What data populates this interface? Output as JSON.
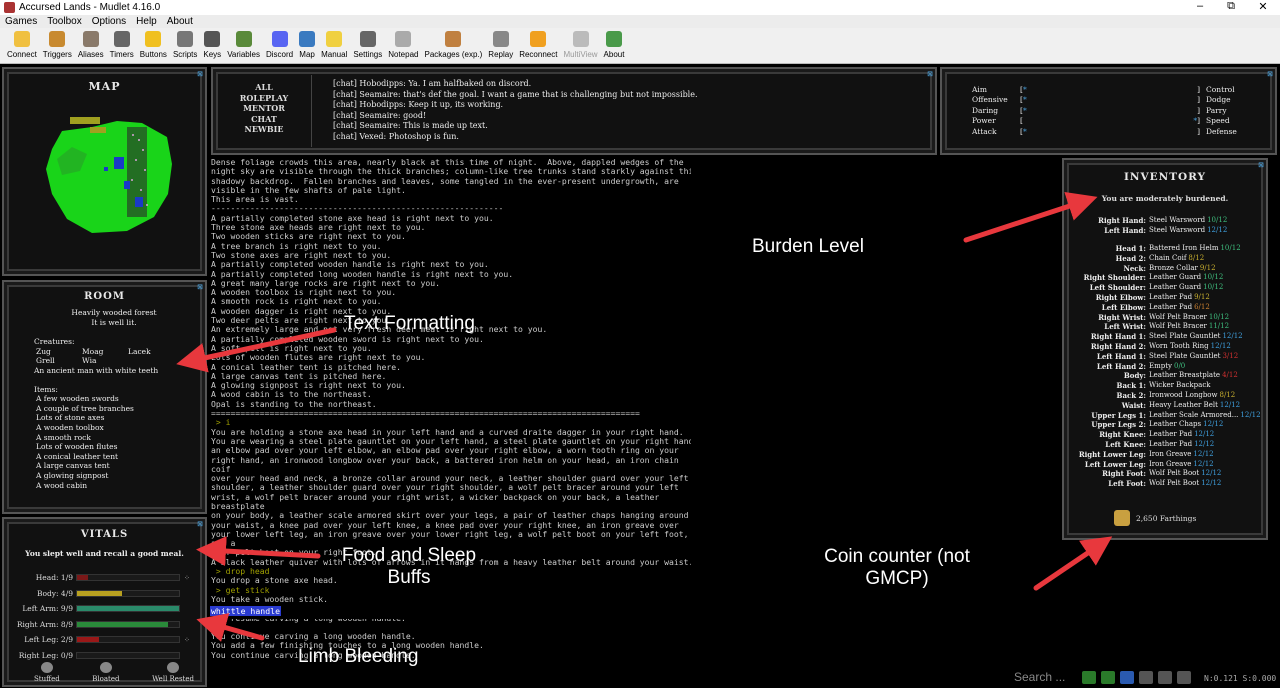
{
  "window": {
    "title": "Accursed Lands - Mudlet 4.16.0",
    "minimize": "–",
    "maximize": "⧉",
    "close": "✕"
  },
  "menu": [
    "Games",
    "Toolbox",
    "Options",
    "Help",
    "About"
  ],
  "toolbar": [
    {
      "label": "Connect",
      "icon": "connect-icon",
      "color": "#f0c040"
    },
    {
      "label": "Triggers",
      "icon": "triggers-icon",
      "color": "#c88a30"
    },
    {
      "label": "Aliases",
      "icon": "aliases-icon",
      "color": "#8a7a6a"
    },
    {
      "label": "Timers",
      "icon": "timers-icon",
      "color": "#666"
    },
    {
      "label": "Buttons",
      "icon": "buttons-icon",
      "color": "#f0c020"
    },
    {
      "label": "Scripts",
      "icon": "scripts-icon",
      "color": "#777"
    },
    {
      "label": "Keys",
      "icon": "keys-icon",
      "color": "#555"
    },
    {
      "label": "Variables",
      "icon": "variables-icon",
      "color": "#5a8a3a"
    },
    {
      "label": "Discord",
      "icon": "discord-icon",
      "color": "#5865f2"
    },
    {
      "label": "Map",
      "icon": "map-icon",
      "color": "#3a7ac0"
    },
    {
      "label": "Manual",
      "icon": "manual-icon",
      "color": "#f0d040"
    },
    {
      "label": "Settings",
      "icon": "settings-icon",
      "color": "#666"
    },
    {
      "label": "Notepad",
      "icon": "notepad-icon",
      "color": "#aaa"
    },
    {
      "label": "Packages (exp.)",
      "icon": "packages-icon",
      "color": "#c08040"
    },
    {
      "label": "Replay",
      "icon": "replay-icon",
      "color": "#888"
    },
    {
      "label": "Reconnect",
      "icon": "reconnect-icon",
      "color": "#f0a020"
    },
    {
      "label": "MultiView",
      "icon": "multiview-icon",
      "color": "#bbb"
    },
    {
      "label": "About",
      "icon": "about-icon",
      "color": "#4a9a4a"
    }
  ],
  "map": {
    "title": "MAP"
  },
  "room": {
    "title": "ROOM",
    "name": "Heavily wooded forest",
    "light": "It is well lit.",
    "creatures_label": "Creatures:",
    "creatures": [
      "Zug",
      "Moag",
      "Lacek",
      "Grell",
      "Wia"
    ],
    "npc": "An ancient man with white teeth",
    "items_label": "Items:",
    "items": [
      "A few wooden swords",
      "A couple of tree branches",
      "Lots of stone axes",
      "A wooden toolbox",
      "A smooth rock",
      "Lots of wooden flutes",
      "A conical leather tent",
      "A large canvas tent",
      "A glowing signpost",
      "A wood cabin"
    ]
  },
  "vitals": {
    "title": "VITALS",
    "status": "You slept well and recall a good meal.",
    "limbs": [
      {
        "label": "Head: 1/9",
        "fill": 0.11,
        "color": "#7a1818",
        "blood": ""
      },
      {
        "label": "Body: 4/9",
        "fill": 0.44,
        "color": "#b8a020",
        "blood": ""
      },
      {
        "label": "Left Arm: 9/9",
        "fill": 1.0,
        "color": "#2a8a6a",
        "blood": ""
      },
      {
        "label": "Right Arm: 8/9",
        "fill": 0.89,
        "color": "#2a8a3a",
        "blood": ""
      },
      {
        "label": "Left Leg: 2/9",
        "fill": 0.22,
        "color": "#9a1818",
        "blood": "⁘"
      },
      {
        "label": "Right Leg: 0/9",
        "fill": 0.0,
        "color": "#333",
        "blood": ""
      }
    ],
    "head_blood": "⁘",
    "buffs": [
      {
        "label": "Stuffed",
        "icon": "stuffed-icon"
      },
      {
        "label": "Bloated",
        "icon": "bloated-icon"
      },
      {
        "label": "Well Rested",
        "icon": "well-rested-icon"
      }
    ]
  },
  "chat": {
    "tabs": [
      "ALL",
      "ROLEPLAY",
      "MENTOR",
      "CHAT",
      "NEWBIE"
    ],
    "lines": [
      "[chat] Hobodipps: Ya. I am halfbaked on discord.",
      "[chat] Seamaire: that's def the goal. I want a game that is challenging but not impossible.",
      "[chat] Hobodipps: Keep it up, its working.",
      "[chat] Seamaire: good!",
      "[chat] Seamaire: This is made up text.",
      "[chat] Vexed: Photoshop is fun."
    ]
  },
  "combat": [
    {
      "left": "Aim",
      "mark": "*",
      "right": "Control",
      "star_end": false
    },
    {
      "left": "Offensive",
      "mark": "*",
      "right": "Dodge",
      "star_end": false
    },
    {
      "left": "Daring",
      "mark": "*",
      "right": "Parry",
      "star_end": false
    },
    {
      "left": "Power",
      "mark": "",
      "right": "Speed",
      "star_end": true
    },
    {
      "left": "Attack",
      "mark": "*",
      "right": "Defense",
      "star_end": false
    }
  ],
  "maintext": [
    {
      "t": "Dense foliage crowds this area, nearly black at this time of night.  Above, dappled wedges of the",
      "c": ""
    },
    {
      "t": "night sky are visible through the thick branches; column-like tree trunks stand starkly against this",
      "c": ""
    },
    {
      "t": "shadowy backdrop.  Fallen branches and leaves, some tangled in the ever-present undergrowth, are",
      "c": ""
    },
    {
      "t": "visible in the few shafts of pale light.",
      "c": ""
    },
    {
      "t": "This area is vast.",
      "c": ""
    },
    {
      "t": "------------------------------------------------------------",
      "c": "sep"
    },
    {
      "t": "A partially completed stone axe head is right next to you.",
      "c": ""
    },
    {
      "t": "Three stone axe heads are right next to you.",
      "c": ""
    },
    {
      "t": "Two wooden sticks are right next to you.",
      "c": ""
    },
    {
      "t": "A tree branch is right next to you.",
      "c": ""
    },
    {
      "t": "Two stone axes are right next to you.",
      "c": ""
    },
    {
      "t": "A partially completed wooden handle is right next to you.",
      "c": ""
    },
    {
      "t": "A partially completed long wooden handle is right next to you.",
      "c": ""
    },
    {
      "t": "A great many large rocks are right next to you.",
      "c": ""
    },
    {
      "t": "A wooden toolbox is right next to you.",
      "c": ""
    },
    {
      "t": "A smooth rock is right next to you.",
      "c": ""
    },
    {
      "t": "A wooden dagger is right next to you.",
      "c": ""
    },
    {
      "t": "Two deer pelts are right next to you.",
      "c": ""
    },
    {
      "t": "An extremely large and not very fresh deer meat is right next to you.",
      "c": ""
    },
    {
      "t": "A partially completed wooden sword is right next to you.",
      "c": ""
    },
    {
      "t": "A soft pelt is right next to you.",
      "c": ""
    },
    {
      "t": "Lots of wooden flutes are right next to you.",
      "c": ""
    },
    {
      "t": "A conical leather tent is pitched here.",
      "c": ""
    },
    {
      "t": "A large canvas tent is pitched here.",
      "c": ""
    },
    {
      "t": "A glowing signpost is right next to you.",
      "c": ""
    },
    {
      "t": "A wood cabin is to the northeast.",
      "c": ""
    },
    {
      "t": "Opal is standing to the northeast.",
      "c": ""
    },
    {
      "t": "========================================================================================",
      "c": "sep"
    },
    {
      "t": " > i",
      "c": "cmd"
    },
    {
      "t": "You are holding a stone axe head in your left hand and a curved draite dagger in your right hand.",
      "c": ""
    },
    {
      "t": "You are wearing a steel plate gauntlet on your left hand, a steel plate gauntlet on your right hand,",
      "c": ""
    },
    {
      "t": "an elbow pad over your left elbow, an elbow pad over your right elbow, a worn tooth ring on your",
      "c": ""
    },
    {
      "t": "right hand, an ironwood longbow over your back, a battered iron helm on your head, an iron chain",
      "c": ""
    },
    {
      "t": "coif",
      "c": ""
    },
    {
      "t": "over your head and neck, a bronze collar around your neck, a leather shoulder guard over your left",
      "c": ""
    },
    {
      "t": "shoulder, a leather shoulder guard over your right shoulder, a wolf pelt bracer around your left",
      "c": ""
    },
    {
      "t": "wrist, a wolf pelt bracer around your right wrist, a wicker backpack on your back, a leather",
      "c": ""
    },
    {
      "t": "breastplate",
      "c": ""
    },
    {
      "t": "on your body, a leather scale armored skirt over your legs, a pair of leather chaps hanging around",
      "c": ""
    },
    {
      "t": "your waist, a knee pad over your left knee, a knee pad over your right knee, an iron greave over",
      "c": ""
    },
    {
      "t": "your lower left leg, an iron greave over your lower right leg, a wolf pelt boot on your left foot,",
      "c": ""
    },
    {
      "t": "and a",
      "c": ""
    },
    {
      "t": "wolf pelt boot on your right foot.",
      "c": ""
    },
    {
      "t": "A black leather quiver with lots of arrows in it hangs from a heavy leather belt around your waist.",
      "c": ""
    },
    {
      "t": " > drop head",
      "c": "cmd"
    },
    {
      "t": "You drop a stone axe head.",
      "c": ""
    },
    {
      "t": " > get stick",
      "c": "cmd"
    },
    {
      "t": "You take a wooden stick.",
      "c": ""
    },
    {
      "t": " > whittle handle",
      "c": "cmd"
    },
    {
      "t": "You resume carving a long wooden handle.",
      "c": ""
    },
    {
      "t": "",
      "c": ""
    },
    {
      "t": "You continue carving a long wooden handle.",
      "c": ""
    },
    {
      "t": "You add a few finishing touches to a long wooden handle.",
      "c": ""
    },
    {
      "t": "You continue carving a long wooden handle.",
      "c": ""
    }
  ],
  "command_input": "whittle handle",
  "inventory": {
    "title": "INVENTORY",
    "burden": "You are moderately burdened.",
    "hands": [
      {
        "slot": "Right Hand:",
        "item": "Steel Warsword",
        "cond": "10/12",
        "color": "#3fbf7f"
      },
      {
        "slot": "Left Hand:",
        "item": "Steel Warsword",
        "cond": "12/12",
        "color": "#3fa0df"
      }
    ],
    "slots": [
      {
        "slot": "Head 1:",
        "item": "Battered Iron Helm",
        "cond": "10/12",
        "color": "#3fbf7f"
      },
      {
        "slot": "Head 2:",
        "item": "Chain Coif",
        "cond": "8/12",
        "color": "#c9b030"
      },
      {
        "slot": "Neck:",
        "item": "Bronze Collar",
        "cond": "9/12",
        "color": "#c9b030"
      },
      {
        "slot": "Right Shoulder:",
        "item": "Leather Guard",
        "cond": "10/12",
        "color": "#3fbf7f"
      },
      {
        "slot": "Left Shoulder:",
        "item": "Leather Guard",
        "cond": "10/12",
        "color": "#3fbf7f"
      },
      {
        "slot": "Right Elbow:",
        "item": "Leather Pad",
        "cond": "9/12",
        "color": "#c9b030"
      },
      {
        "slot": "Left Elbow:",
        "item": "Leather Pad",
        "cond": "6/12",
        "color": "#c98030"
      },
      {
        "slot": "Right Wrist:",
        "item": "Wolf Pelt Bracer",
        "cond": "10/12",
        "color": "#3fbf7f"
      },
      {
        "slot": "Left Wrist:",
        "item": "Wolf Pelt Bracer",
        "cond": "11/12",
        "color": "#3fbf7f"
      },
      {
        "slot": "Right Hand 1:",
        "item": "Steel Plate Gauntlet",
        "cond": "12/12",
        "color": "#3fa0df"
      },
      {
        "slot": "Right Hand 2:",
        "item": "Worn Tooth Ring",
        "cond": "12/12",
        "color": "#3fa0df"
      },
      {
        "slot": "Left Hand 1:",
        "item": "Steel Plate Gauntlet",
        "cond": "3/12",
        "color": "#d03030"
      },
      {
        "slot": "Left Hand 2:",
        "item": "Empty",
        "cond": "0/0",
        "color": "#3fbf7f"
      },
      {
        "slot": "Body:",
        "item": "Leather Breastplate",
        "cond": "4/12",
        "color": "#d03030"
      },
      {
        "slot": "Back 1:",
        "item": "Wicker Backpack",
        "cond": "",
        "color": "#3fbf7f"
      },
      {
        "slot": "Back 2:",
        "item": "Ironwood Longbow",
        "cond": "8/12",
        "color": "#c9b030"
      },
      {
        "slot": "Waist:",
        "item": "Heavy Leather Belt",
        "cond": "12/12",
        "color": "#3fa0df"
      },
      {
        "slot": "Upper Legs 1:",
        "item": "Leather Scale Armored...",
        "cond": "12/12",
        "color": "#3fa0df"
      },
      {
        "slot": "Upper Legs 2:",
        "item": "Leather Chaps",
        "cond": "12/12",
        "color": "#3fa0df"
      },
      {
        "slot": "Right Knee:",
        "item": "Leather Pad",
        "cond": "12/12",
        "color": "#3fa0df"
      },
      {
        "slot": "Left Knee:",
        "item": "Leather Pad",
        "cond": "12/12",
        "color": "#3fa0df"
      },
      {
        "slot": "Right Lower Leg:",
        "item": "Iron Greave",
        "cond": "12/12",
        "color": "#3fa0df"
      },
      {
        "slot": "Left Lower Leg:",
        "item": "Iron Greave",
        "cond": "12/12",
        "color": "#3fa0df"
      },
      {
        "slot": "Right Foot:",
        "item": "Wolf Pelt Boot",
        "cond": "12/12",
        "color": "#3fa0df"
      },
      {
        "slot": "Left Foot:",
        "item": "Wolf Pelt Boot",
        "cond": "12/12",
        "color": "#3fa0df"
      }
    ],
    "coins": "2,650 Farthings"
  },
  "annotations": {
    "text_formatting": "Text Formatting",
    "burden_level": "Burden Level",
    "food_sleep_1": "Food and Sleep",
    "food_sleep_2": "Buffs",
    "limb_bleeding": "Limb Bleeding",
    "coin_1": "Coin counter (not",
    "coin_2": "GMCP)",
    "arrow_color": "#e8383d"
  },
  "statusbar": {
    "search": "Search ...",
    "net": "N:0.121 S:0.000"
  }
}
